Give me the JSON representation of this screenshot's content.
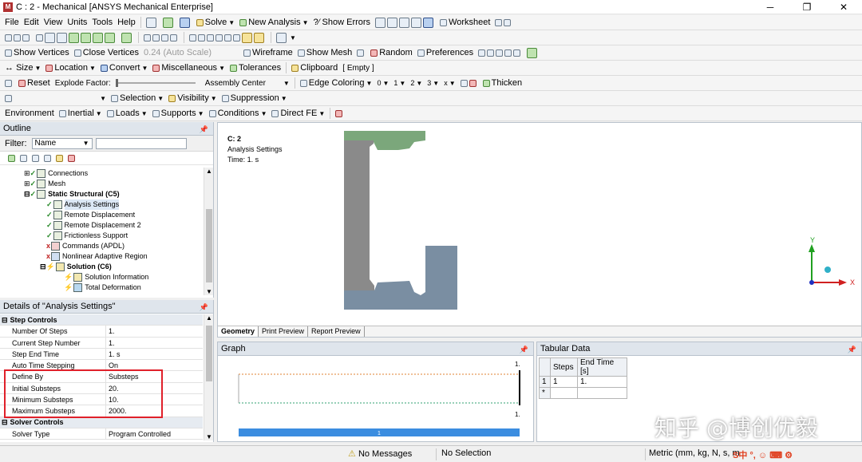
{
  "title_bar": {
    "title": "C : 2 - Mechanical [ANSYS Mechanical Enterprise]",
    "minimize": "─",
    "maximize": "❐",
    "close": "✕"
  },
  "menu": {
    "items": [
      "File",
      "Edit",
      "View",
      "Units",
      "Tools",
      "Help"
    ],
    "solve": "Solve",
    "new_analysis": "New Analysis",
    "show_errors": "?⁄ Show Errors",
    "worksheet": "Worksheet"
  },
  "toolbar3": {
    "show_vertices": "Show Vertices",
    "close_vertices": "Close Vertices",
    "auto_scale": "0.24 (Auto Scale)",
    "wireframe": "Wireframe",
    "show_mesh": "Show Mesh",
    "random": "Random",
    "preferences": "Preferences"
  },
  "toolbar4": {
    "size": "Size",
    "location": "Location",
    "convert": "Convert",
    "miscellaneous": "Miscellaneous",
    "tolerances": "Tolerances",
    "clipboard": "Clipboard",
    "empty": "[ Empty ]"
  },
  "toolbar5": {
    "reset": "Reset",
    "explode_factor": "Explode Factor:",
    "assembly_center": "Assembly Center",
    "edge_coloring": "Edge Coloring",
    "c0": "0",
    "c1": "1",
    "c2": "2",
    "c3": "3",
    "cx": "x",
    "thicken": "Thicken"
  },
  "toolbar6": {
    "selection": "Selection",
    "visibility": "Visibility",
    "suppression": "Suppression"
  },
  "toolbar7": {
    "environment": "Environment",
    "inertial": "Inertial",
    "loads": "Loads",
    "supports": "Supports",
    "conditions": "Conditions",
    "direct_fe": "Direct FE"
  },
  "outline": {
    "header": "Outline",
    "filter_label": "Filter:",
    "filter_value": "Name",
    "tree": [
      {
        "label": "Connections",
        "bold": false
      },
      {
        "label": "Mesh",
        "bold": false
      },
      {
        "label": "Static Structural (C5)",
        "bold": true
      },
      {
        "label": "Analysis Settings",
        "bold": false
      },
      {
        "label": "Remote Displacement",
        "bold": false
      },
      {
        "label": "Remote Displacement 2",
        "bold": false
      },
      {
        "label": "Frictionless Support",
        "bold": false
      },
      {
        "label": "Commands (APDL)",
        "bold": false
      },
      {
        "label": "Nonlinear Adaptive Region",
        "bold": false
      },
      {
        "label": "Solution (C6)",
        "bold": true
      },
      {
        "label": "Solution Information",
        "bold": false
      },
      {
        "label": "Total Deformation",
        "bold": false
      }
    ]
  },
  "details": {
    "header": "Details of \"Analysis Settings\"",
    "rows": [
      {
        "group": true,
        "key": "Step Controls",
        "value": ""
      },
      {
        "group": false,
        "key": "Number Of Steps",
        "value": "1."
      },
      {
        "group": false,
        "key": "Current Step Number",
        "value": "1."
      },
      {
        "group": false,
        "key": "Step End Time",
        "value": "1. s"
      },
      {
        "group": false,
        "key": "Auto Time Stepping",
        "value": "On"
      },
      {
        "group": false,
        "key": "Define By",
        "value": "Substeps"
      },
      {
        "group": false,
        "key": "Initial Substeps",
        "value": "20."
      },
      {
        "group": false,
        "key": "Minimum Substeps",
        "value": "10."
      },
      {
        "group": false,
        "key": "Maximum Substeps",
        "value": "2000."
      },
      {
        "group": true,
        "key": "Solver Controls",
        "value": ""
      },
      {
        "group": false,
        "key": "Solver Type",
        "value": "Program Controlled"
      }
    ]
  },
  "viewport": {
    "name": "C: 2",
    "subtitle": "Analysis Settings",
    "time": "Time: 1. s",
    "axis_y": "Y",
    "axis_x": "X",
    "tabs": [
      "Geometry",
      "Print Preview",
      "Report Preview"
    ],
    "part_gray": "#8a8a8a",
    "part_green": "#7ba77b",
    "part_blue": "#7a8ea2"
  },
  "graph": {
    "header": "Graph",
    "top_tick": "1.",
    "right_tick": "1.",
    "bottom_tick": "1.",
    "bar_label": "1"
  },
  "tabular": {
    "header": "Tabular Data",
    "col_steps": "Steps",
    "col_end_time": "End Time [s]",
    "row_num": "1",
    "row_step": "1",
    "row_time": "1.",
    "new_row": "*"
  },
  "status": {
    "messages": "No Messages",
    "selection": "No Selection",
    "units": "Metric (mm, kg, N, s, m",
    "watermark": "知乎 @博创优毅"
  }
}
